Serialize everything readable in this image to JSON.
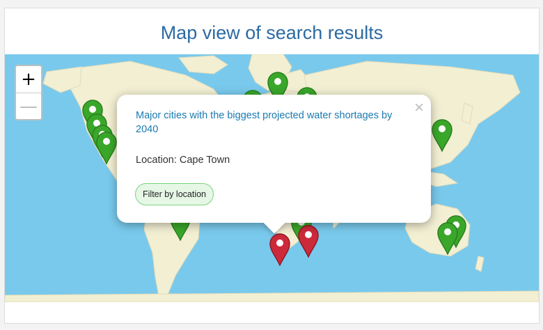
{
  "page": {
    "title": "Map view of search results"
  },
  "map": {
    "zoom_in_label": "+",
    "zoom_out_label": "—",
    "colors": {
      "water": "#79c9ec",
      "land": "#f2efd3",
      "marker_result": "#3aa72a",
      "marker_selected": "#cc2a3a"
    },
    "markers": {
      "green_count": 16,
      "red_count": 2
    }
  },
  "popup": {
    "title": "Major cities with the biggest projected water shortages by 2040",
    "location_label": "Location: Cape Town",
    "filter_button": "Filter by location",
    "close_glyph": "×"
  }
}
